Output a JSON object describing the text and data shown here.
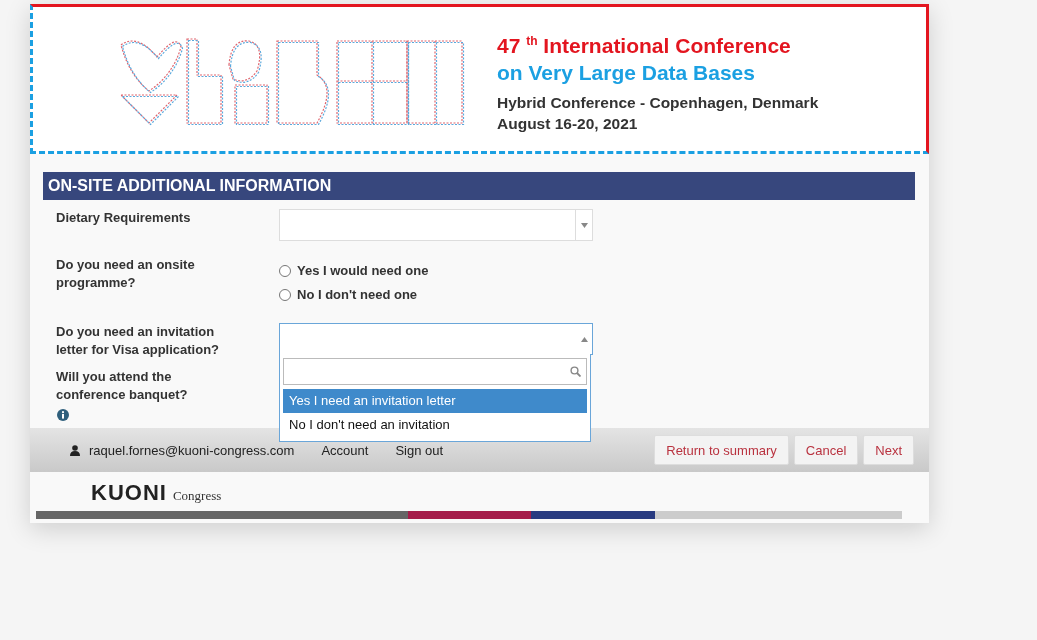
{
  "banner": {
    "title": "47 $^{th}$ International Conference",
    "subtitle": "on Very Large Data Bases",
    "location": "Hybrid Conference - Copenhagen, Denmark",
    "dates": "August 16-20, 2021"
  },
  "section": {
    "title": "ON-SITE ADDITIONAL INFORMATION",
    "fields": [
      {
        "kind": "select",
        "label": "Dietary Requirements",
        "open": false
      },
      {
        "kind": "radio",
        "label": "Do you need an onsite programme?",
        "options": [
          {
            "label": "Yes I would need one",
            "selected": false
          },
          {
            "label": "No I don't need one",
            "selected": false
          }
        ]
      },
      {
        "kind": "select",
        "label": "Do you need an invitation letter for Visa application?",
        "open": true,
        "options": [
          {
            "label": "Yes I need an invitation letter",
            "selected": true
          },
          {
            "label": "No I don't need an invitation",
            "selected": false
          }
        ]
      },
      {
        "kind": "info",
        "label": "Will you attend the conference banquet?"
      }
    ]
  },
  "footer": {
    "user": "raquel.fornes@kuoni-congress.com",
    "links": [
      "Account",
      "Sign out"
    ],
    "buttons": [
      "Return to summary",
      "Cancel",
      "Next"
    ]
  },
  "brand": {
    "name": "KUONI",
    "tagline": "Congress"
  }
}
